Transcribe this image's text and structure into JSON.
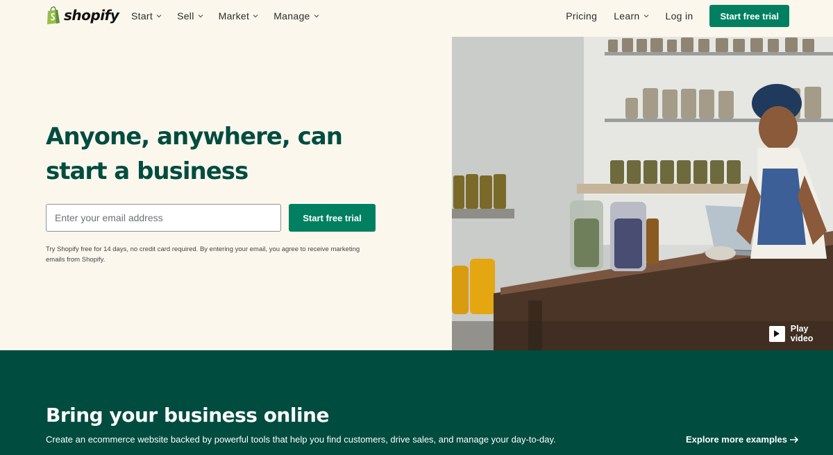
{
  "header": {
    "logo_text": "shopify",
    "nav_left": [
      {
        "label": "Start"
      },
      {
        "label": "Sell"
      },
      {
        "label": "Market"
      },
      {
        "label": "Manage"
      }
    ],
    "pricing_label": "Pricing",
    "learn_label": "Learn",
    "login_label": "Log in",
    "cta_label": "Start free trial"
  },
  "hero": {
    "title_line1": "Anyone, anywhere, can",
    "title_line2": "start a business",
    "email_placeholder": "Enter your email address",
    "cta_label": "Start free trial",
    "disclaimer": "Try Shopify free for 14 days, no credit card required. By entering your email, you agree to receive marketing emails from Shopify.",
    "play_video_label": "Play video"
  },
  "band": {
    "title": "Bring your business online",
    "text": "Create an ecommerce website backed by powerful tools that help you find customers, drive sales, and manage your day-to-day.",
    "explore_label": "Explore more examples"
  },
  "colors": {
    "brand_green": "#008060",
    "dark_green": "#004c3f",
    "cream": "#fbf7ed"
  },
  "icons": [
    "shopify-bag-icon",
    "chevron-down-icon",
    "play-icon",
    "arrow-right-icon"
  ]
}
